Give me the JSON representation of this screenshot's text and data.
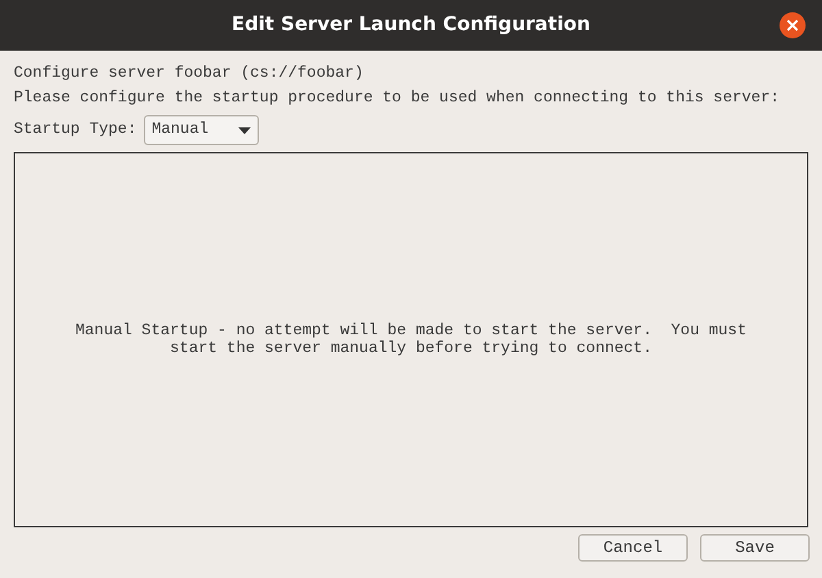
{
  "window": {
    "title": "Edit Server Launch Configuration"
  },
  "intro": [
    "Configure server foobar (cs://foobar)",
    "Please configure the startup procedure to be used when connecting to this server:"
  ],
  "startup_type": {
    "label": "Startup Type:",
    "value": "Manual"
  },
  "panel": {
    "message": "Manual Startup - no attempt will be made to start the server.  You must start the server manually before trying to connect."
  },
  "buttons": [
    "Cancel",
    "Save"
  ]
}
